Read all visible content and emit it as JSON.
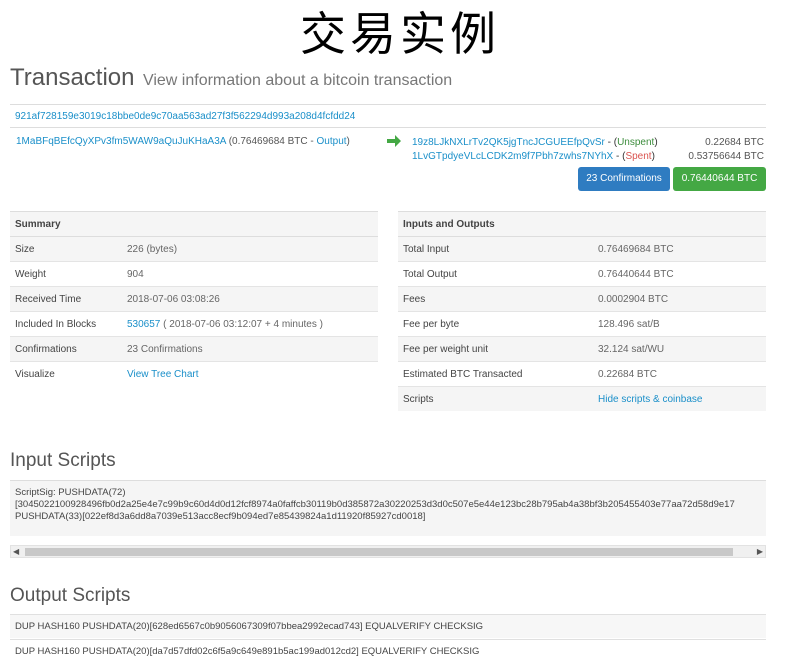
{
  "banner": "交易实例",
  "header": {
    "title": "Transaction",
    "subtitle": "View information about a bitcoin transaction"
  },
  "tx": {
    "hash": "921af728159e3019c18bbe0de9c70aa563ad27f3f562294d993a208d4fcfdd24",
    "input": {
      "address": "1MaBFqBEfcQyXPv3fm5WAW9aQuJuKHaA3A",
      "amount": "(0.76469684 BTC - ",
      "link": "Output",
      "close": ")"
    },
    "outputs": [
      {
        "address": "19z8LJkNXLrTv2QK5jgTncJCGUEEfpQvSr",
        "sep": " - (",
        "status": "Unspent",
        "close": ")",
        "value": "0.22684 BTC"
      },
      {
        "address": "1LvGTpdyeVLcLCDK2m9f7Pbh7zwhs7NYhX",
        "sep": " - (",
        "status": "Spent",
        "close": ")",
        "value": "0.53756644 BTC"
      }
    ],
    "confirmations_button": "23 Confirmations",
    "total_button": "0.76440644 BTC"
  },
  "summary": {
    "heading": "Summary",
    "size_label": "Size",
    "size_value": "226 (bytes)",
    "weight_label": "Weight",
    "weight_value": "904",
    "received_label": "Received Time",
    "received_value": "2018-07-06 03:08:26",
    "block_label": "Included In Blocks",
    "block_link": "530657",
    "block_rest": " ( 2018-07-06 03:12:07 + 4 minutes )",
    "conf_label": "Confirmations",
    "conf_value": "23 Confirmations",
    "vis_label": "Visualize",
    "vis_link": "View Tree Chart"
  },
  "inouts": {
    "heading": "Inputs and Outputs",
    "total_input_label": "Total Input",
    "total_input_value": "0.76469684 BTC",
    "total_output_label": "Total Output",
    "total_output_value": "0.76440644 BTC",
    "fees_label": "Fees",
    "fees_value": "0.0002904 BTC",
    "fee_byte_label": "Fee per byte",
    "fee_byte_value": "128.496 sat/B",
    "fee_wu_label": "Fee per weight unit",
    "fee_wu_value": "32.124 sat/WU",
    "est_label": "Estimated BTC Transacted",
    "est_value": "0.22684 BTC",
    "scripts_label": "Scripts",
    "scripts_link": "Hide scripts & coinbase"
  },
  "input_scripts": {
    "title": "Input Scripts",
    "line1": "ScriptSig: PUSHDATA(72)",
    "line2": "[3045022100928496fb0d2a25e4e7c99b9c60d4d0d12fcf8974a0faffcb30119b0d385872a30220253d3d0c507e5e44e123bc28b795ab4a38bf3b205455403e77aa72d58d9e17",
    "line3": "PUSHDATA(33)[022ef8d3a6dd8a7039e513acc8ecf9b094ed7e85439824a1d11920f85927cd0018]"
  },
  "output_scripts": {
    "title": "Output Scripts",
    "lines": [
      "DUP HASH160 PUSHDATA(20)[628ed6567c0b9056067309f07bbea2992ecad743] EQUALVERIFY CHECKSIG",
      "DUP HASH160 PUSHDATA(20)[da7d57dfd02c6f5a9c649e891b5ac199ad012cd2] EQUALVERIFY CHECKSIG"
    ]
  },
  "colors": {
    "link": "#1a8fc9",
    "confirm_button": "#2f7cc1",
    "total_button": "#44a844",
    "unspent": "#3c8c3c",
    "spent": "#d9534f",
    "arrow": "#44a844"
  },
  "icons": {
    "arrow": "arrow-right-icon",
    "scroll_left": "scroll-left-icon",
    "scroll_right": "scroll-right-icon"
  }
}
